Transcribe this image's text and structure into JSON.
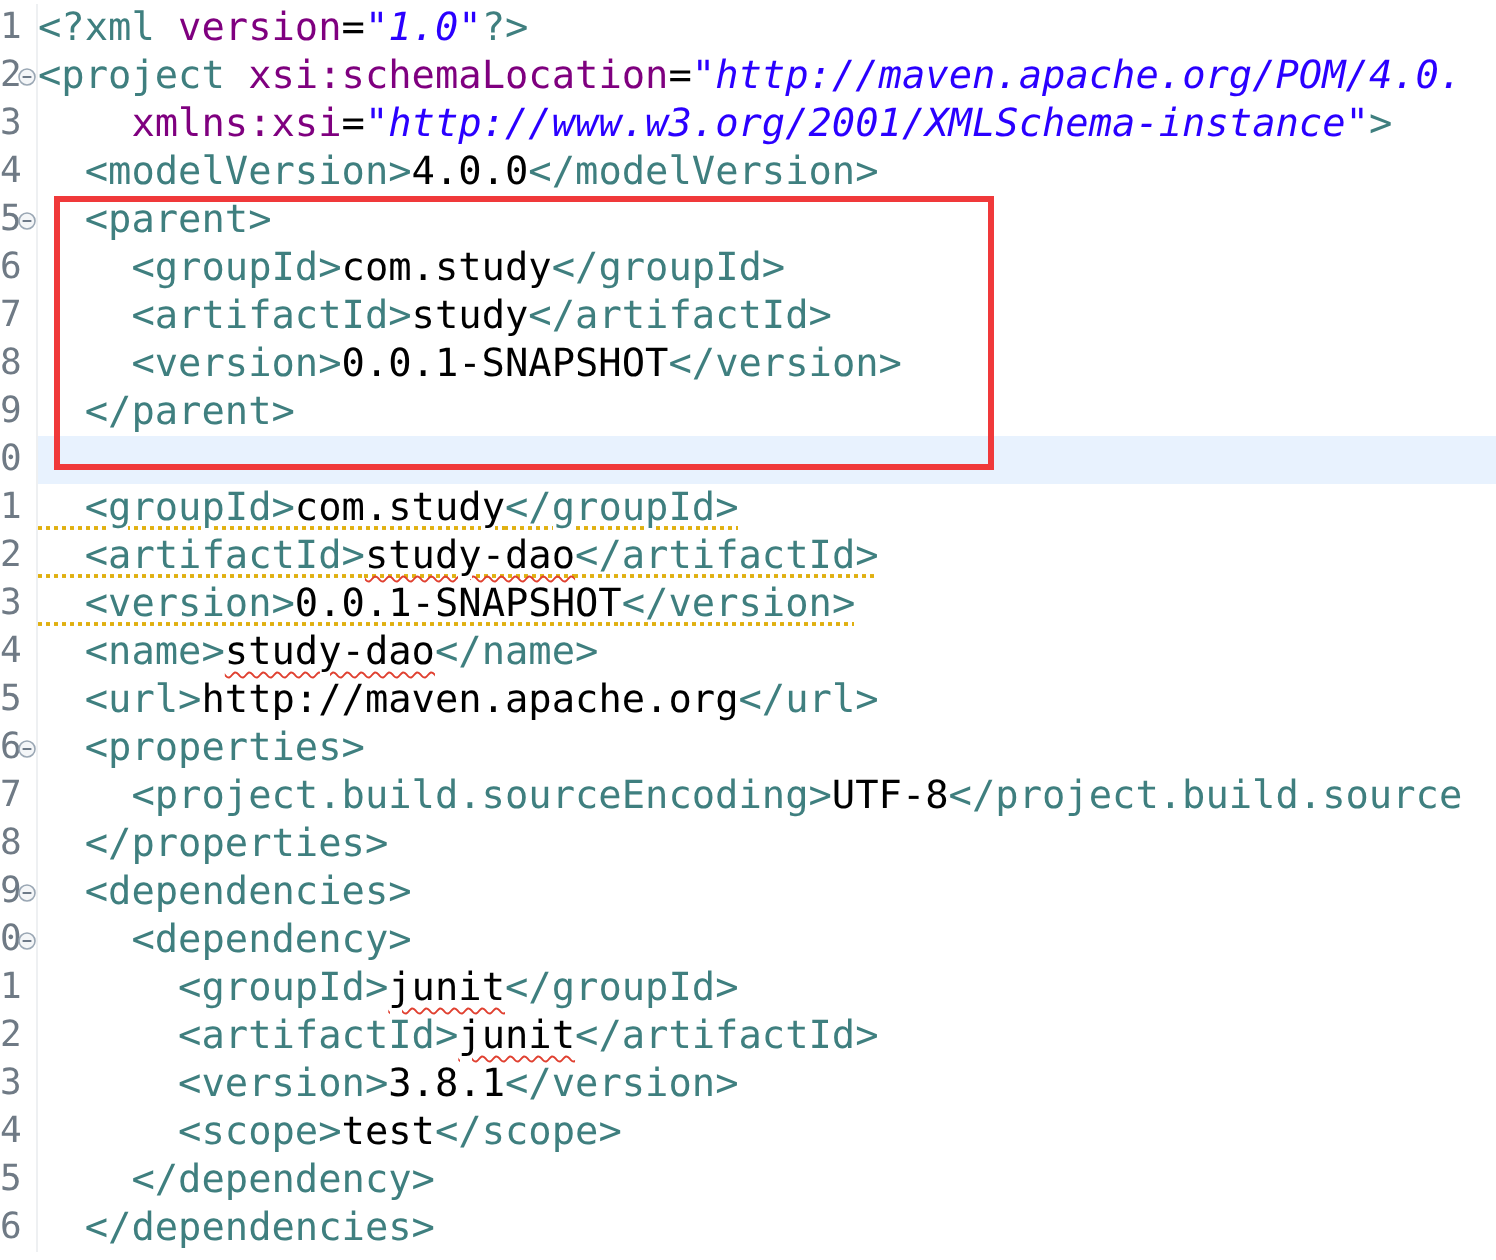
{
  "editor": {
    "lines": [
      {
        "number": "1",
        "foldable": false,
        "current": false,
        "tokens": [
          {
            "kind": "tag",
            "text": "<?xml "
          },
          {
            "kind": "attr",
            "text": "version"
          },
          {
            "kind": "plain",
            "text": "="
          },
          {
            "kind": "string",
            "text": "\"1.0\""
          },
          {
            "kind": "tag",
            "text": "?>"
          }
        ]
      },
      {
        "number": "2",
        "foldable": true,
        "current": false,
        "tokens": [
          {
            "kind": "tag",
            "text": "<project "
          },
          {
            "kind": "attr",
            "text": "xsi:schemaLocation"
          },
          {
            "kind": "plain",
            "text": "="
          },
          {
            "kind": "string",
            "text": "\"http://maven.apache.org/POM/4.0."
          }
        ]
      },
      {
        "number": "3",
        "foldable": false,
        "current": false,
        "tokens": [
          {
            "kind": "attr",
            "text": "    xmlns:xsi"
          },
          {
            "kind": "plain",
            "text": "="
          },
          {
            "kind": "string",
            "text": "\"http://www.w3.org/2001/XMLSchema-instance\""
          },
          {
            "kind": "tag",
            "text": ">"
          }
        ]
      },
      {
        "number": "4",
        "foldable": false,
        "current": false,
        "tokens": [
          {
            "kind": "tag",
            "text": "  <modelVersion>"
          },
          {
            "kind": "plain",
            "text": "4.0.0"
          },
          {
            "kind": "tag",
            "text": "</modelVersion>"
          }
        ]
      },
      {
        "number": "5",
        "foldable": true,
        "current": false,
        "tokens": [
          {
            "kind": "tag",
            "text": "  <parent>"
          }
        ]
      },
      {
        "number": "6",
        "foldable": false,
        "current": false,
        "tokens": [
          {
            "kind": "tag",
            "text": "    <groupId>"
          },
          {
            "kind": "plain",
            "text": "com.study"
          },
          {
            "kind": "tag",
            "text": "</groupId>"
          }
        ]
      },
      {
        "number": "7",
        "foldable": false,
        "current": false,
        "tokens": [
          {
            "kind": "tag",
            "text": "    <artifactId>"
          },
          {
            "kind": "plain",
            "text": "study"
          },
          {
            "kind": "tag",
            "text": "</artifactId>"
          }
        ]
      },
      {
        "number": "8",
        "foldable": false,
        "current": false,
        "tokens": [
          {
            "kind": "tag",
            "text": "    <version>"
          },
          {
            "kind": "plain",
            "text": "0.0.1-SNAPSHOT"
          },
          {
            "kind": "tag",
            "text": "</version>"
          }
        ]
      },
      {
        "number": "9",
        "foldable": false,
        "current": false,
        "tokens": [
          {
            "kind": "tag",
            "text": "  </parent>"
          }
        ]
      },
      {
        "number": "0",
        "foldable": false,
        "current": true
      },
      {
        "number": "1",
        "foldable": false,
        "current": false,
        "warning": true,
        "tokens": [
          {
            "kind": "tag",
            "text": "  <groupId>"
          },
          {
            "kind": "plain",
            "text": "com.study"
          },
          {
            "kind": "tag",
            "text": "</groupId>"
          }
        ]
      },
      {
        "number": "2",
        "foldable": false,
        "current": false,
        "warning": true,
        "tokens": [
          {
            "kind": "tag",
            "text": "  <artifactId>"
          },
          {
            "kind": "plain",
            "text": "study-dao",
            "spelling": true
          },
          {
            "kind": "tag",
            "text": "</artifactId>"
          }
        ]
      },
      {
        "number": "3",
        "foldable": false,
        "current": false,
        "warning": true,
        "tokens": [
          {
            "kind": "tag",
            "text": "  <version>"
          },
          {
            "kind": "plain",
            "text": "0.0.1-SNAPSHOT"
          },
          {
            "kind": "tag",
            "text": "</version>"
          }
        ]
      },
      {
        "number": "4",
        "foldable": false,
        "current": false,
        "tokens": [
          {
            "kind": "tag",
            "text": "  <name>"
          },
          {
            "kind": "plain",
            "text": "study-dao",
            "spelling": true
          },
          {
            "kind": "tag",
            "text": "</name>"
          }
        ]
      },
      {
        "number": "5",
        "foldable": false,
        "current": false,
        "tokens": [
          {
            "kind": "tag",
            "text": "  <url>"
          },
          {
            "kind": "plain",
            "text": "http://maven.apache.org"
          },
          {
            "kind": "tag",
            "text": "</url>"
          }
        ]
      },
      {
        "number": "6",
        "foldable": true,
        "current": false,
        "tokens": [
          {
            "kind": "tag",
            "text": "  <properties>"
          }
        ]
      },
      {
        "number": "7",
        "foldable": false,
        "current": false,
        "tokens": [
          {
            "kind": "tag",
            "text": "    <project.build.sourceEncoding>"
          },
          {
            "kind": "plain",
            "text": "UTF-8"
          },
          {
            "kind": "tag",
            "text": "</project.build.source"
          }
        ]
      },
      {
        "number": "8",
        "foldable": false,
        "current": false,
        "tokens": [
          {
            "kind": "tag",
            "text": "  </properties>"
          }
        ]
      },
      {
        "number": "9",
        "foldable": true,
        "current": false,
        "tokens": [
          {
            "kind": "tag",
            "text": "  <dependencies>"
          }
        ]
      },
      {
        "number": "0",
        "foldable": true,
        "current": false,
        "tokens": [
          {
            "kind": "tag",
            "text": "    <dependency>"
          }
        ]
      },
      {
        "number": "1",
        "foldable": false,
        "current": false,
        "tokens": [
          {
            "kind": "tag",
            "text": "      <groupId>"
          },
          {
            "kind": "plain",
            "text": "junit",
            "spelling": true
          },
          {
            "kind": "tag",
            "text": "</groupId>"
          }
        ]
      },
      {
        "number": "2",
        "foldable": false,
        "current": false,
        "tokens": [
          {
            "kind": "tag",
            "text": "      <artifactId>"
          },
          {
            "kind": "plain",
            "text": "junit",
            "spelling": true
          },
          {
            "kind": "tag",
            "text": "</artifactId>"
          }
        ]
      },
      {
        "number": "3",
        "foldable": false,
        "current": false,
        "tokens": [
          {
            "kind": "tag",
            "text": "      <version>"
          },
          {
            "kind": "plain",
            "text": "3.8.1"
          },
          {
            "kind": "tag",
            "text": "</version>"
          }
        ]
      },
      {
        "number": "4",
        "foldable": false,
        "current": false,
        "tokens": [
          {
            "kind": "tag",
            "text": "      <scope>"
          },
          {
            "kind": "plain",
            "text": "test"
          },
          {
            "kind": "tag",
            "text": "</scope>"
          }
        ]
      },
      {
        "number": "5",
        "foldable": false,
        "current": false,
        "tokens": [
          {
            "kind": "tag",
            "text": "    </dependency>"
          }
        ]
      },
      {
        "number": "6",
        "foldable": false,
        "current": false,
        "tokens": [
          {
            "kind": "tag",
            "text": "  </dependencies>"
          }
        ]
      }
    ]
  }
}
